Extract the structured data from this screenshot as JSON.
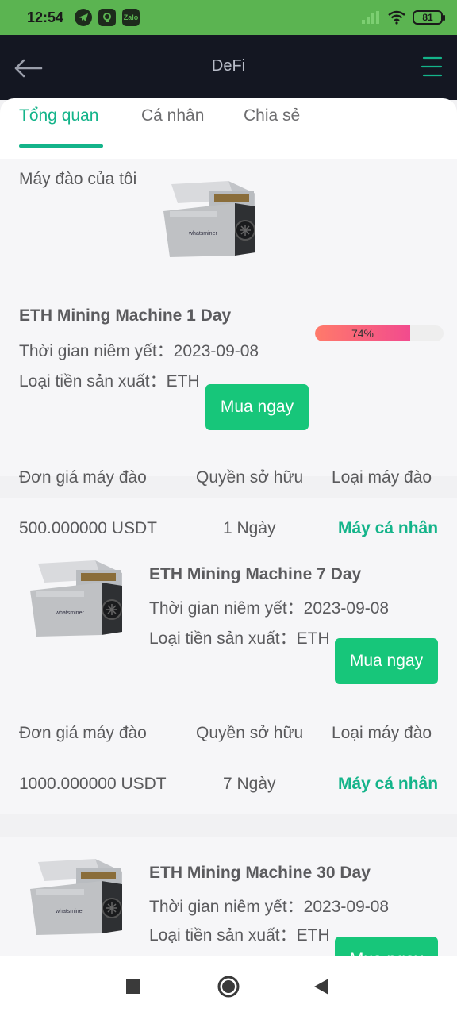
{
  "status_bar": {
    "time": "12:54",
    "app_icons": [
      "telegram-icon",
      "chat-app-icon",
      "zalo-icon"
    ],
    "zalo_label": "Zalo",
    "battery": "81"
  },
  "header": {
    "title": "DeFi"
  },
  "tabs": [
    {
      "label": "Tổng quan"
    },
    {
      "label": "Cá nhân"
    },
    {
      "label": "Chia sẻ"
    }
  ],
  "my_miners": {
    "section_title": "Máy đào của tôi",
    "title": "ETH Mining Machine 1 Day",
    "listing_line": "Thời gian niêm yết：2023-09-08",
    "currency_line": "Loại tiền sản xuất：ETH",
    "buy_label": "Mua ngay",
    "progress_percent": 74,
    "progress_label": "74%",
    "columns": {
      "price": "Đơn giá máy đào",
      "ownership": "Quyền sở hữu",
      "type": "Loại máy đào"
    }
  },
  "products": [
    {
      "price": "500.000000 USDT",
      "ownership": "1 Ngày",
      "type": "Máy cá nhân",
      "title": "ETH Mining Machine 7 Day",
      "listing_line": "Thời gian niêm yết：2023-09-08",
      "currency_line": "Loại tiền sản xuất：ETH",
      "buy_label": "Mua ngay",
      "columns": {
        "price": "Đơn giá máy đào",
        "ownership": "Quyền sở hữu",
        "type": "Loại máy đào"
      }
    },
    {
      "price": "1000.000000 USDT",
      "ownership": "7 Ngày",
      "type": "Máy cá nhân",
      "title": "ETH Mining Machine 30 Day",
      "listing_line": "Thời gian niêm yết：2023-09-08",
      "currency_line": "Loại tiền sản xuất：ETH",
      "buy_label": "Mua ngay"
    }
  ],
  "colors": {
    "accent": "#14b48a",
    "buy_button": "#17c67a",
    "header_bg": "#141722",
    "status_bg": "#5bb451"
  }
}
